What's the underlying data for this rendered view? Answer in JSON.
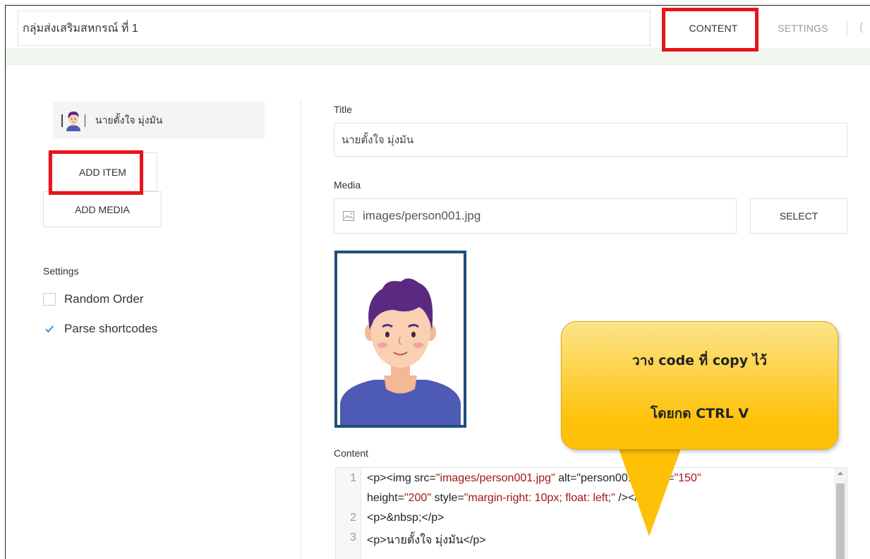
{
  "header": {
    "module_title": "กลุ่มส่งเสริมสหกรณ์ ที่ 1",
    "tabs": [
      {
        "label": "CONTENT",
        "active": true
      },
      {
        "label": "SETTINGS",
        "active": false
      }
    ]
  },
  "sidebar": {
    "items": [
      {
        "label": "นายตั้งใจ มุ่งมัน"
      }
    ],
    "add_item_label": "ADD ITEM",
    "add_media_label": "ADD MEDIA",
    "settings_label": "Settings",
    "options": [
      {
        "label": "Random Order",
        "checked": false
      },
      {
        "label": "Parse shortcodes",
        "checked": true
      }
    ]
  },
  "form": {
    "title_label": "Title",
    "title_value": "นายตั้งใจ มุ่งมัน",
    "media_label": "Media",
    "media_value": "images/person001.jpg",
    "select_label": "SELECT",
    "content_label": "Content"
  },
  "code": {
    "line_numbers": [
      "1",
      "2",
      "3"
    ],
    "line1_open": "<p><img src=",
    "line1_src": "\"images/person001.jpg\"",
    "line1_alt": " alt=\"person001\"",
    "line1_width_attr": " width=",
    "line1_width": "\"150\"",
    "line1b_height_attr": "height=",
    "line1b_height": "\"200\"",
    "line1b_style_attr": " style=",
    "line1b_style": "\"margin-right: 10px; float: left;\"",
    "line1b_close": " /></p>",
    "line2": "<p>&nbsp;</p>",
    "line3": "<p>นายตั้งใจ มุ่งมัน</p>"
  },
  "callout": {
    "line1": "วาง code ที่ copy ไว้",
    "line2": "โดยกด CTRL V"
  },
  "colors": {
    "highlight": "#e8141b",
    "callout": "#ffc107",
    "checkbox": "#1e87f0",
    "photo_frame": "#1e4f7a"
  },
  "icons": [
    "image-icon",
    "checkmark-icon",
    "avatar-icon"
  ]
}
